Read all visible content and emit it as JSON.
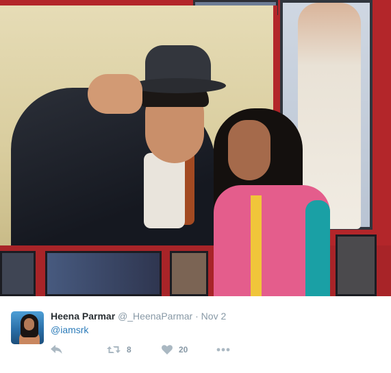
{
  "photo": {
    "description_icon": "photo-icon"
  },
  "tweet": {
    "display_name": "Heena Parmar",
    "screen_name": "@_HeenaParmar",
    "separator": "·",
    "timestamp": "Nov 2",
    "text": "@iamsrk",
    "actions": {
      "reply_icon": "reply-icon",
      "retweet_icon": "retweet-icon",
      "retweet_count": "8",
      "like_icon": "heart-icon",
      "like_count": "20",
      "more_icon": "more-icon"
    }
  },
  "colors": {
    "link": "#2b7bb9",
    "muted": "#8899a6",
    "icon": "#aab8c2",
    "text": "#292f33"
  }
}
